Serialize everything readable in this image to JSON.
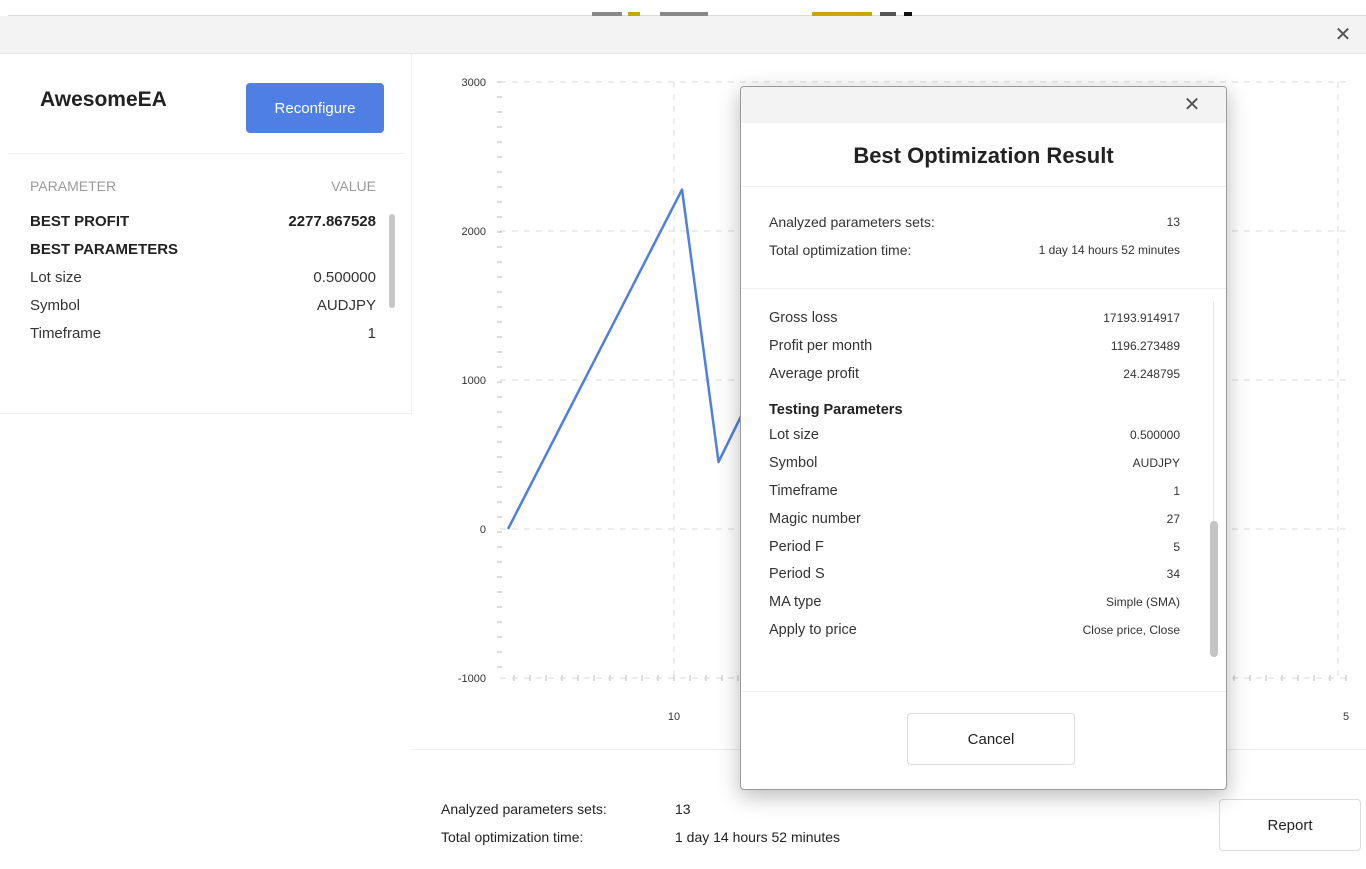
{
  "app": {
    "title": "AwesomeEA",
    "reconfigure_label": "Reconfigure",
    "close_symbol": "✕",
    "accent_color": "#4f7fe3"
  },
  "params_table": {
    "header_param": "PARAMETER",
    "header_value": "VALUE",
    "best_profit_label": "BEST PROFIT",
    "best_profit_value": "2277.867528",
    "best_parameters_label": "BEST PARAMETERS",
    "rows": [
      {
        "label": "Lot size",
        "value": "0.500000"
      },
      {
        "label": "Symbol",
        "value": "AUDJPY"
      },
      {
        "label": "Timeframe",
        "value": "1"
      }
    ]
  },
  "chart_data": {
    "type": "line",
    "ylim": [
      -1000,
      3000
    ],
    "y_ticks": [
      "3000",
      "2000",
      "1000",
      "0",
      "-1000"
    ],
    "x_tick_labels": [
      "10",
      "5"
    ],
    "grid": true,
    "series": [
      {
        "color": "#4f7fe3",
        "x": [
          0,
          1,
          1.21,
          1.98,
          2.18,
          2.57
        ],
        "y": [
          0,
          2278,
          450,
          2278,
          450,
          1370
        ]
      }
    ]
  },
  "summary": {
    "analyzed_label": "Analyzed parameters sets:",
    "analyzed_value": "13",
    "time_label": "Total optimization time:",
    "time_value": "1 day 14 hours 52 minutes",
    "report_label": "Report"
  },
  "modal": {
    "title": "Best Optimization Result",
    "close_symbol": "✕",
    "analyzed_label": "Analyzed parameters sets:",
    "analyzed_value": "13",
    "time_label": "Total optimization time:",
    "time_value": "1 day 14 hours 52 minutes",
    "metrics": [
      {
        "label": "Gross loss",
        "value": "17193.914917"
      },
      {
        "label": "Profit per month",
        "value": "1196.273489"
      },
      {
        "label": "Average profit",
        "value": "24.248795"
      }
    ],
    "testing_title": "Testing Parameters",
    "testing": [
      {
        "label": "Lot size",
        "value": "0.500000"
      },
      {
        "label": "Symbol",
        "value": "AUDJPY"
      },
      {
        "label": "Timeframe",
        "value": "1"
      },
      {
        "label": "Magic number",
        "value": "27"
      },
      {
        "label": "Period F",
        "value": "5"
      },
      {
        "label": "Period S",
        "value": "34"
      },
      {
        "label": "MA type",
        "value": "Simple (SMA)"
      },
      {
        "label": "Apply to price",
        "value": "Close price, Close"
      }
    ],
    "cancel_label": "Cancel"
  }
}
